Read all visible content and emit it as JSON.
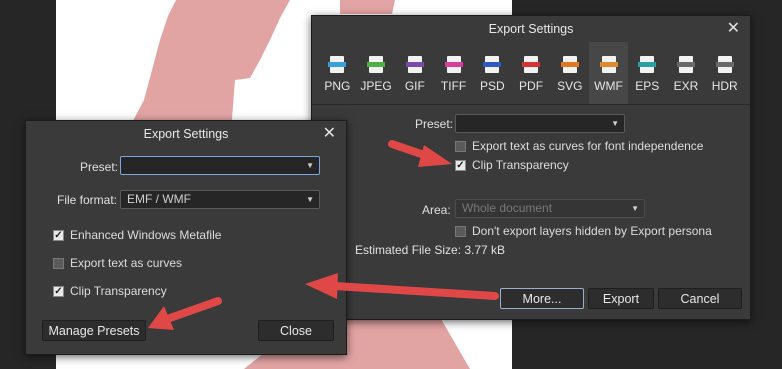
{
  "big_dialog": {
    "title": "Export Settings",
    "formats": [
      {
        "label": "PNG",
        "icon": "png-file-icon",
        "color": "#3aa0d8"
      },
      {
        "label": "JPEG",
        "icon": "jpeg-file-icon",
        "color": "#4fae48"
      },
      {
        "label": "GIF",
        "icon": "gif-file-icon",
        "color": "#7a4aa8"
      },
      {
        "label": "TIFF",
        "icon": "tiff-file-icon",
        "color": "#d6409a"
      },
      {
        "label": "PSD",
        "icon": "psd-file-icon",
        "color": "#2f59c4"
      },
      {
        "label": "PDF",
        "icon": "pdf-file-icon",
        "color": "#d43434"
      },
      {
        "label": "SVG",
        "icon": "svg-file-icon",
        "color": "#e07a20"
      },
      {
        "label": "WMF",
        "icon": "wmf-file-icon",
        "color": "#e08a30"
      },
      {
        "label": "EPS",
        "icon": "eps-file-icon",
        "color": "#2aa0a0"
      },
      {
        "label": "EXR",
        "icon": "exr-file-icon",
        "color": "#6a6a6a"
      },
      {
        "label": "HDR",
        "icon": "hdr-file-icon",
        "color": "#6a6a6a"
      }
    ],
    "selected_format": "WMF",
    "preset_label": "Preset:",
    "preset_value": "",
    "export_text_curves": "Export text as curves for font independence",
    "clip_transparency": "Clip Transparency",
    "area_label": "Area:",
    "area_value": "Whole document",
    "dont_export_hidden": "Don't export layers hidden by Export persona",
    "estimated_size": "Estimated File Size: 3.77 kB",
    "more_button": "More...",
    "export_button": "Export",
    "cancel_button": "Cancel"
  },
  "small_dialog": {
    "title": "Export Settings",
    "preset_label": "Preset:",
    "preset_value": "",
    "file_format_label": "File format:",
    "file_format_value": "EMF / WMF",
    "enhanced_metafile": "Enhanced Windows Metafile",
    "export_text_curves": "Export text as curves",
    "clip_transparency": "Clip Transparency",
    "manage_presets": "Manage Presets",
    "close_button": "Close"
  },
  "colors": {
    "dialog_bg": "#3a3a3a",
    "arrow_red": "#e04848",
    "tree_pink": "#e2a3a3"
  }
}
